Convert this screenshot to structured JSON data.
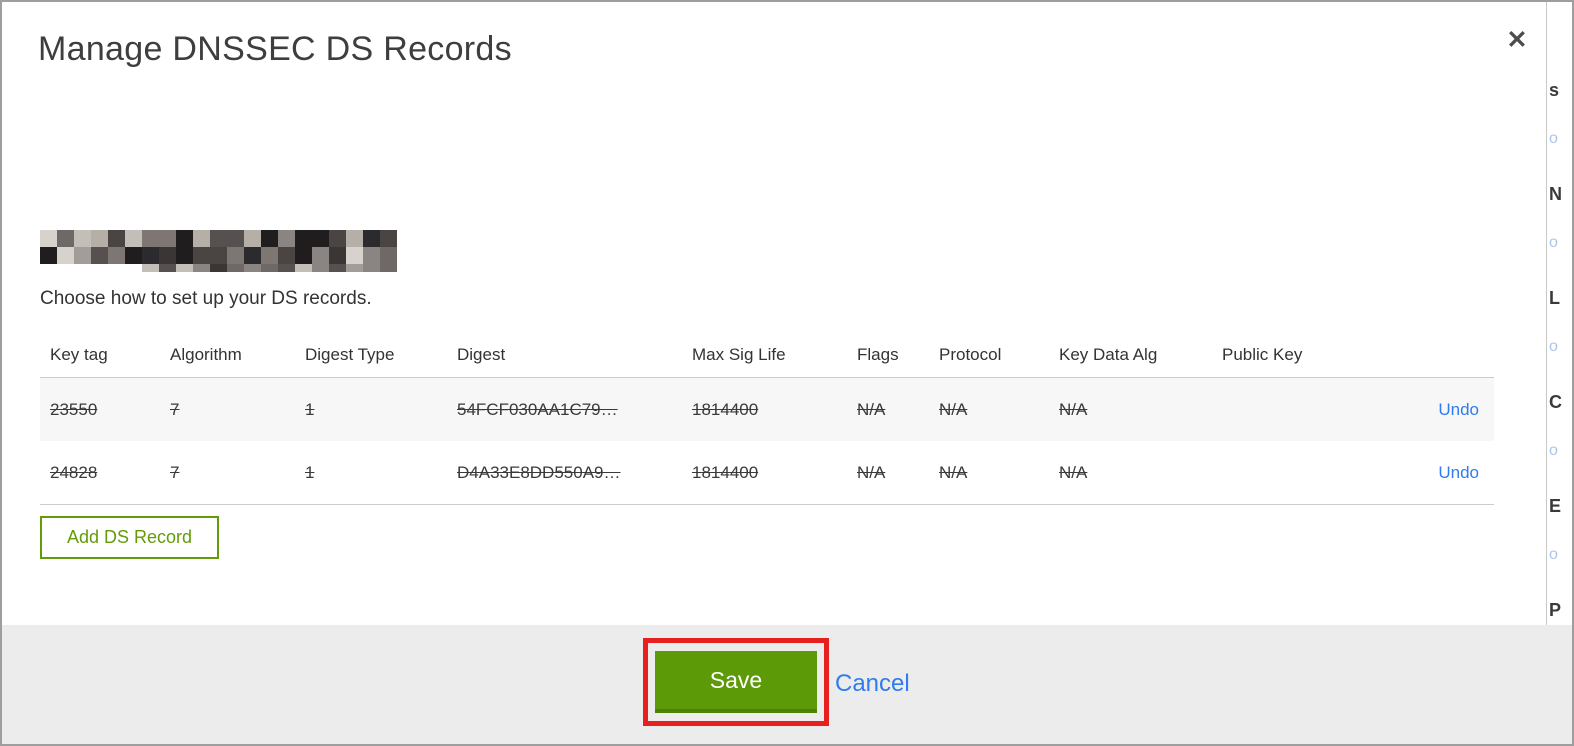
{
  "dialog": {
    "title": "Manage DNSSEC DS Records",
    "close_label": "✕",
    "subtitle": "Choose how to set up your DS records.",
    "domain_name_redacted": true
  },
  "table": {
    "headers": [
      "Key tag",
      "Algorithm",
      "Digest Type",
      "Digest",
      "Max Sig Life",
      "Flags",
      "Protocol",
      "Key Data Alg",
      "Public Key"
    ],
    "rows": [
      {
        "key_tag": "23550",
        "algorithm": "7",
        "digest_type": "1",
        "digest": "54FCF030AA1C79…",
        "max_sig_life": "1814400",
        "flags": "N/A",
        "protocol": "N/A",
        "key_data_alg": "N/A",
        "public_key": "",
        "action": "Undo",
        "state": "marked-for-deletion"
      },
      {
        "key_tag": "24828",
        "algorithm": "7",
        "digest_type": "1",
        "digest": "D4A33E8DD550A9…",
        "max_sig_life": "1814400",
        "flags": "N/A",
        "protocol": "N/A",
        "key_data_alg": "N/A",
        "public_key": "",
        "action": "Undo",
        "state": "marked-for-deletion"
      }
    ],
    "add_button_label": "Add DS Record"
  },
  "footer": {
    "save_label": "Save",
    "cancel_label": "Cancel",
    "save_button_annotated_with_red_box": true
  },
  "background_page_edge": {
    "letters": [
      "s",
      "N",
      "L",
      "C",
      "E",
      "P"
    ],
    "link_bits": [
      "o",
      "o",
      "o",
      "o",
      "o"
    ]
  },
  "colors": {
    "accent_green": "#5c9a08",
    "green_dark": "#4c8106",
    "add_button_green": "#639b0a",
    "link_blue": "#2e7cf0",
    "annotation_red": "#e81f1f",
    "footer_bg": "#ececec",
    "row_alt_bg": "#f7f7f7",
    "mosaic_palette": [
      "#1f1d1e",
      "#3a3636",
      "#565051",
      "#6e6867",
      "#8a8482",
      "#a39d99",
      "#c4beb8",
      "#d8d2cc",
      "#4a4443",
      "#2b2a2e",
      "#7d7672",
      "#b5afa8"
    ]
  }
}
